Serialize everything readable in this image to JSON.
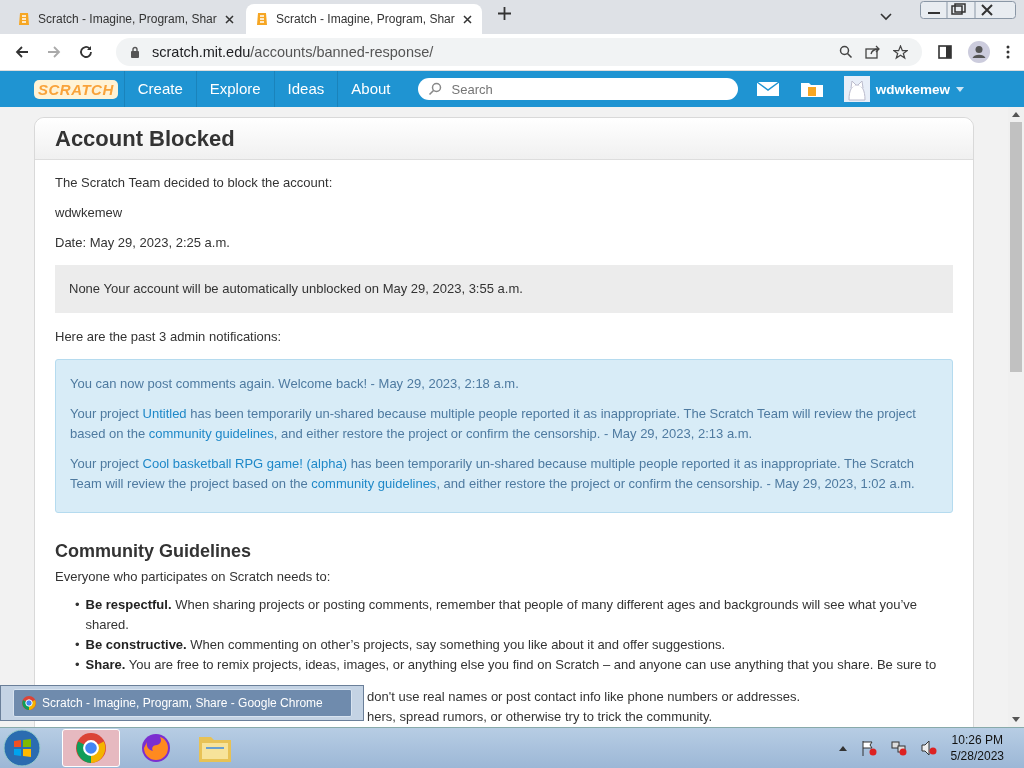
{
  "browser": {
    "tabs": [
      {
        "title": "Scratch - Imagine, Program, Shar",
        "selected": false
      },
      {
        "title": "Scratch - Imagine, Program, Shar",
        "selected": true
      }
    ],
    "address": {
      "host": "scratch.mit.edu",
      "path": "/accounts/banned-response/"
    }
  },
  "nav": {
    "logo": "SCRATCH",
    "links": [
      "Create",
      "Explore",
      "Ideas",
      "About"
    ],
    "search": {
      "placeholder": "Search"
    },
    "username": "wdwkemew"
  },
  "page": {
    "title": "Account Blocked",
    "intro": "The Scratch Team decided to block the account:",
    "username": "wdwkemew",
    "date": "Date: May 29, 2023, 2:25 a.m.",
    "notice": "None Your account will be automatically unblocked on May 29, 2023, 3:55 a.m.",
    "notifications_heading": "Here are the past 3 admin notifications:",
    "notifications": [
      [
        {
          "kind": "text",
          "text": "You can now post comments again. Welcome back! - May 29, 2023, 2:18 a.m."
        }
      ],
      [
        {
          "kind": "text",
          "text": "Your project "
        },
        {
          "kind": "link",
          "text": "Untitled"
        },
        {
          "kind": "text",
          "text": " has been temporarily un-shared because multiple people reported it as inappropriate. The Scratch Team will review the project based on the "
        },
        {
          "kind": "link",
          "text": "community guidelines"
        },
        {
          "kind": "text",
          "text": ", and either restore the project or confirm the censorship. - May 29, 2023, 2:13 a.m."
        }
      ],
      [
        {
          "kind": "text",
          "text": "Your project "
        },
        {
          "kind": "link",
          "text": "Cool basketball RPG game! (alpha)"
        },
        {
          "kind": "text",
          "text": " has been temporarily un-shared because multiple people reported it as inappropriate. The Scratch Team will review the project based on the "
        },
        {
          "kind": "link",
          "text": "community guidelines"
        },
        {
          "kind": "text",
          "text": ", and either restore the project or confirm the censorship. - May 29, 2023, 1:02 a.m."
        }
      ]
    ]
  },
  "guidelines": {
    "title": "Community Guidelines",
    "intro": "Everyone who participates on Scratch needs to:",
    "items": [
      {
        "marker": "•",
        "bold": "Be respectful.",
        "text": "When sharing projects or posting comments, remember that people of many different ages and backgrounds will see what you’ve shared."
      },
      {
        "marker": "•",
        "bold": "Be constructive.",
        "text": "When commenting on other’s projects, say something you like about it and offer suggestions."
      },
      {
        "marker": "•",
        "bold": "Share.",
        "text": "You are free to remix projects, ideas, images, or anything else you find on Scratch – and anyone can use anything that you share. Be sure to"
      }
    ],
    "covered_lines": [
      "don't use real names or post contact info like phone numbers or addresses.",
      "hers, spread rumors, or otherwise try to trick the community."
    ]
  },
  "tooltip": "Scratch - Imagine, Program, Share - Google Chrome",
  "taskbar": {
    "time": "10:26 PM",
    "date": "5/28/2023"
  }
}
